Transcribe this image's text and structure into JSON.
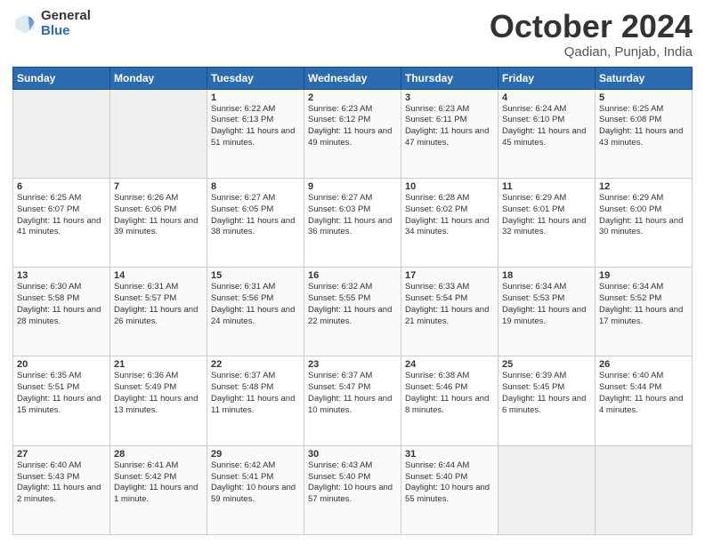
{
  "header": {
    "logo_general": "General",
    "logo_blue": "Blue",
    "month": "October 2024",
    "location": "Qadian, Punjab, India"
  },
  "weekdays": [
    "Sunday",
    "Monday",
    "Tuesday",
    "Wednesday",
    "Thursday",
    "Friday",
    "Saturday"
  ],
  "weeks": [
    [
      null,
      null,
      {
        "day": 1,
        "sunrise": "6:22 AM",
        "sunset": "6:13 PM",
        "daylight": "11 hours and 51 minutes."
      },
      {
        "day": 2,
        "sunrise": "6:23 AM",
        "sunset": "6:12 PM",
        "daylight": "11 hours and 49 minutes."
      },
      {
        "day": 3,
        "sunrise": "6:23 AM",
        "sunset": "6:11 PM",
        "daylight": "11 hours and 47 minutes."
      },
      {
        "day": 4,
        "sunrise": "6:24 AM",
        "sunset": "6:10 PM",
        "daylight": "11 hours and 45 minutes."
      },
      {
        "day": 5,
        "sunrise": "6:25 AM",
        "sunset": "6:08 PM",
        "daylight": "11 hours and 43 minutes."
      }
    ],
    [
      {
        "day": 6,
        "sunrise": "6:25 AM",
        "sunset": "6:07 PM",
        "daylight": "11 hours and 41 minutes."
      },
      {
        "day": 7,
        "sunrise": "6:26 AM",
        "sunset": "6:06 PM",
        "daylight": "11 hours and 39 minutes."
      },
      {
        "day": 8,
        "sunrise": "6:27 AM",
        "sunset": "6:05 PM",
        "daylight": "11 hours and 38 minutes."
      },
      {
        "day": 9,
        "sunrise": "6:27 AM",
        "sunset": "6:03 PM",
        "daylight": "11 hours and 36 minutes."
      },
      {
        "day": 10,
        "sunrise": "6:28 AM",
        "sunset": "6:02 PM",
        "daylight": "11 hours and 34 minutes."
      },
      {
        "day": 11,
        "sunrise": "6:29 AM",
        "sunset": "6:01 PM",
        "daylight": "11 hours and 32 minutes."
      },
      {
        "day": 12,
        "sunrise": "6:29 AM",
        "sunset": "6:00 PM",
        "daylight": "11 hours and 30 minutes."
      }
    ],
    [
      {
        "day": 13,
        "sunrise": "6:30 AM",
        "sunset": "5:58 PM",
        "daylight": "11 hours and 28 minutes."
      },
      {
        "day": 14,
        "sunrise": "6:31 AM",
        "sunset": "5:57 PM",
        "daylight": "11 hours and 26 minutes."
      },
      {
        "day": 15,
        "sunrise": "6:31 AM",
        "sunset": "5:56 PM",
        "daylight": "11 hours and 24 minutes."
      },
      {
        "day": 16,
        "sunrise": "6:32 AM",
        "sunset": "5:55 PM",
        "daylight": "11 hours and 22 minutes."
      },
      {
        "day": 17,
        "sunrise": "6:33 AM",
        "sunset": "5:54 PM",
        "daylight": "11 hours and 21 minutes."
      },
      {
        "day": 18,
        "sunrise": "6:34 AM",
        "sunset": "5:53 PM",
        "daylight": "11 hours and 19 minutes."
      },
      {
        "day": 19,
        "sunrise": "6:34 AM",
        "sunset": "5:52 PM",
        "daylight": "11 hours and 17 minutes."
      }
    ],
    [
      {
        "day": 20,
        "sunrise": "6:35 AM",
        "sunset": "5:51 PM",
        "daylight": "11 hours and 15 minutes."
      },
      {
        "day": 21,
        "sunrise": "6:36 AM",
        "sunset": "5:49 PM",
        "daylight": "11 hours and 13 minutes."
      },
      {
        "day": 22,
        "sunrise": "6:37 AM",
        "sunset": "5:48 PM",
        "daylight": "11 hours and 11 minutes."
      },
      {
        "day": 23,
        "sunrise": "6:37 AM",
        "sunset": "5:47 PM",
        "daylight": "11 hours and 10 minutes."
      },
      {
        "day": 24,
        "sunrise": "6:38 AM",
        "sunset": "5:46 PM",
        "daylight": "11 hours and 8 minutes."
      },
      {
        "day": 25,
        "sunrise": "6:39 AM",
        "sunset": "5:45 PM",
        "daylight": "11 hours and 6 minutes."
      },
      {
        "day": 26,
        "sunrise": "6:40 AM",
        "sunset": "5:44 PM",
        "daylight": "11 hours and 4 minutes."
      }
    ],
    [
      {
        "day": 27,
        "sunrise": "6:40 AM",
        "sunset": "5:43 PM",
        "daylight": "11 hours and 2 minutes."
      },
      {
        "day": 28,
        "sunrise": "6:41 AM",
        "sunset": "5:42 PM",
        "daylight": "11 hours and 1 minute."
      },
      {
        "day": 29,
        "sunrise": "6:42 AM",
        "sunset": "5:41 PM",
        "daylight": "10 hours and 59 minutes."
      },
      {
        "day": 30,
        "sunrise": "6:43 AM",
        "sunset": "5:40 PM",
        "daylight": "10 hours and 57 minutes."
      },
      {
        "day": 31,
        "sunrise": "6:44 AM",
        "sunset": "5:40 PM",
        "daylight": "10 hours and 55 minutes."
      },
      null,
      null
    ]
  ]
}
